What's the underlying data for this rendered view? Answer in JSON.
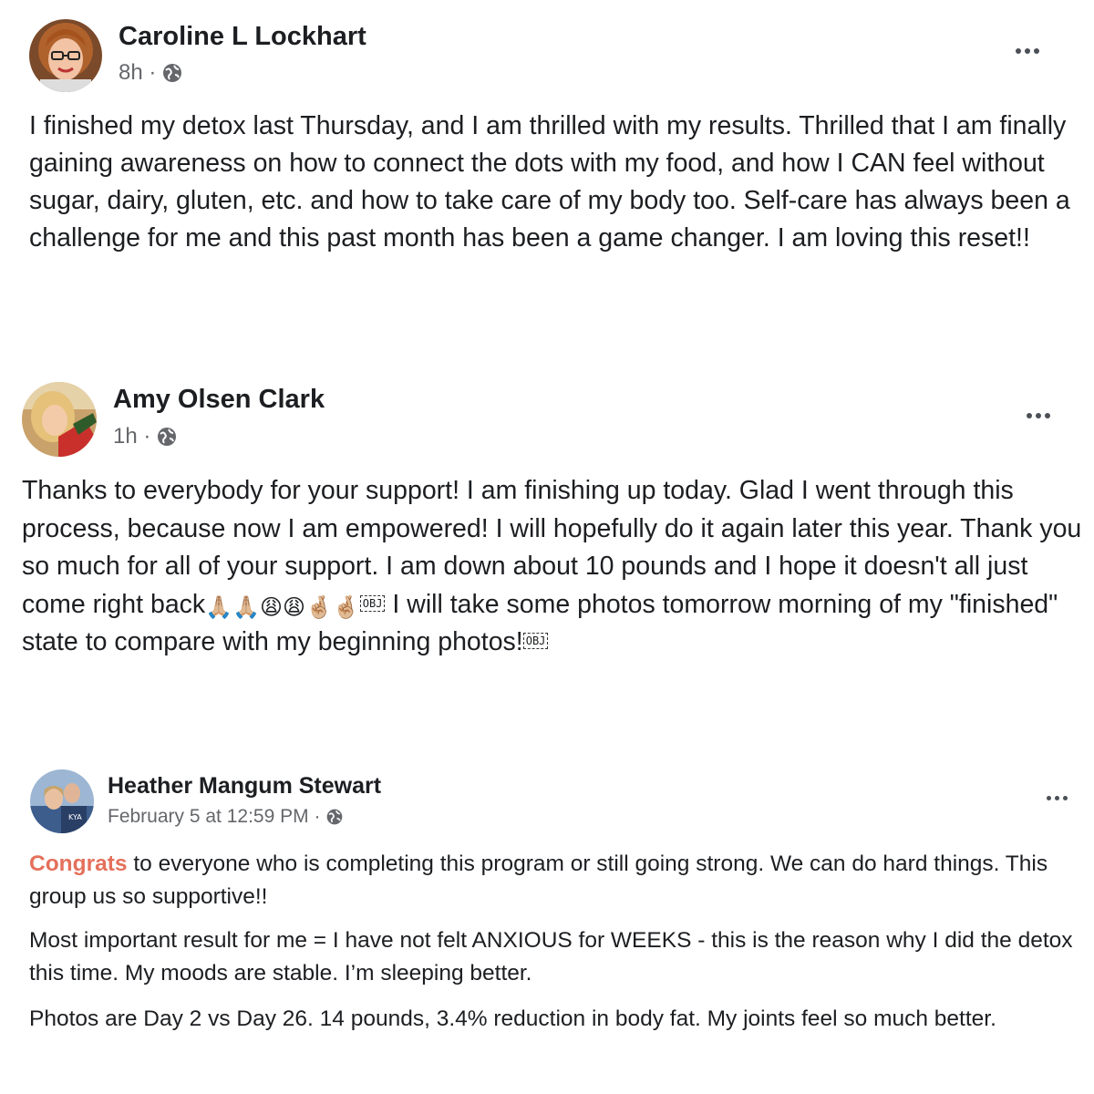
{
  "posts": [
    {
      "author": "Caroline L Lockhart",
      "time": "8h",
      "separator": "·",
      "audience_icon": "globe-icon",
      "body": "I finished my detox last Thursday, and I am thrilled with my results. Thrilled that I am finally gaining awareness on how to connect the dots with my food, and how I CAN feel without sugar, dairy, gluten, etc. and how to take care of my body too. Self-care has always been a challenge for me and this past month has been a game changer. I am loving this reset!!"
    },
    {
      "author": "Amy Olsen Clark",
      "time": "1h",
      "separator": "·",
      "audience_icon": "globe-icon",
      "body_part1": "Thanks to everybody for your support! I am finishing up today. Glad I went through this process, because now I am empowered! I will hopefully do it again later this year. Thank you so much for all of your support. I am down about 10 pounds and I hope it doesn't all just come right back",
      "emojis": [
        "🙏🏼",
        "🙏🏼",
        "😩",
        "😩",
        "🤞🏼",
        "🤞🏼"
      ],
      "obj_glyph": "OBJ",
      "body_part2": " I will take some photos tomorrow morning of my \"finished\" state to compare with my beginning photos!"
    },
    {
      "author": "Heather Mangum Stewart",
      "time": "February 5 at 12:59 PM",
      "separator": "·",
      "audience_icon": "globe-icon",
      "highlight_word": "Congrats",
      "highlight_color": "#e4705b",
      "para1_rest": " to everyone who is completing this program or still going strong.  We can do hard things. This group us so supportive!!",
      "para2": "Most important result for me = I have not felt ANXIOUS for WEEKS - this is the reason why I did the detox this time.  My moods are stable.  I’m sleeping better.",
      "para3": "Photos are Day 2 vs Day 26.  14 pounds, 3.4% reduction in body fat.  My joints feel so much better."
    }
  ]
}
